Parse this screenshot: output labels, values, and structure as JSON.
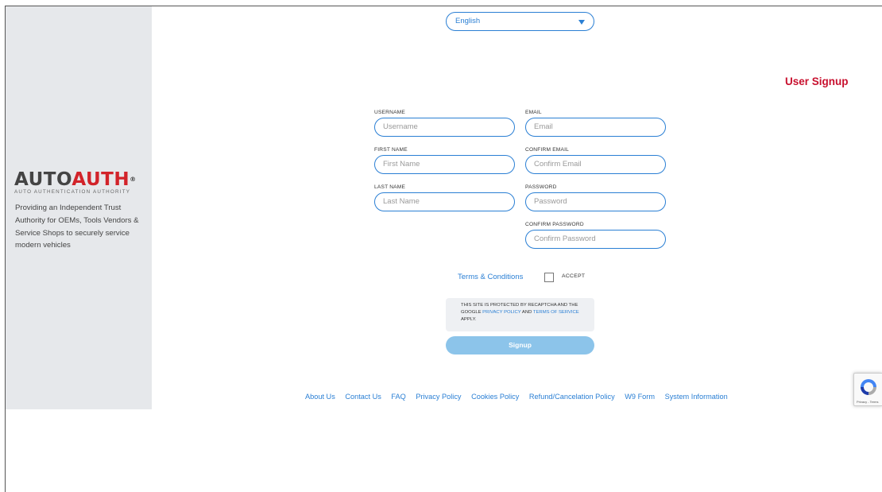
{
  "language": {
    "selected": "English"
  },
  "sidebar": {
    "logo": {
      "part1": "AUTO",
      "part2": "AUTH",
      "sub": "AUTO AUTHENTICATION AUTHORITY",
      "reg": "®"
    },
    "tagline": "Providing an Independent Trust Authority for OEMs, Tools Vendors & Service Shops to securely service modern vehicles"
  },
  "form": {
    "title": "User Signup",
    "fields": {
      "username": {
        "label": "USERNAME",
        "placeholder": "Username"
      },
      "email": {
        "label": "EMAIL",
        "placeholder": "Email"
      },
      "first_name": {
        "label": "FIRST NAME",
        "placeholder": "First Name"
      },
      "confirm_email": {
        "label": "CONFIRM EMAIL",
        "placeholder": "Confirm Email"
      },
      "last_name": {
        "label": "LAST NAME",
        "placeholder": "Last Name"
      },
      "password": {
        "label": "PASSWORD",
        "placeholder": "Password"
      },
      "confirm_password": {
        "label": "CONFIRM PASSWORD",
        "placeholder": "Confirm Password"
      }
    },
    "terms_link": "Terms & Conditions",
    "accept_label": "ACCEPT",
    "recaptcha": {
      "text1": "THIS SITE IS PROTECTED BY RECAPTCHA AND THE GOOGLE ",
      "privacy": "PRIVACY POLICY",
      "and": " AND ",
      "terms": "TERMS OF SERVICE",
      "apply": " APPLY."
    },
    "submit_label": "Signup"
  },
  "footer": {
    "links": [
      "About Us",
      "Contact Us",
      "FAQ",
      "Privacy Policy",
      "Cookies Policy",
      "Refund/Cancelation Policy",
      "W9 Form",
      "System Information"
    ]
  },
  "badge": {
    "text": "Privacy - Terms"
  },
  "colors": {
    "accent": "#2a7fd4",
    "title_red": "#c8102e",
    "sidebar_bg": "#e6e8eb",
    "button_bg": "#8cc4ea"
  }
}
